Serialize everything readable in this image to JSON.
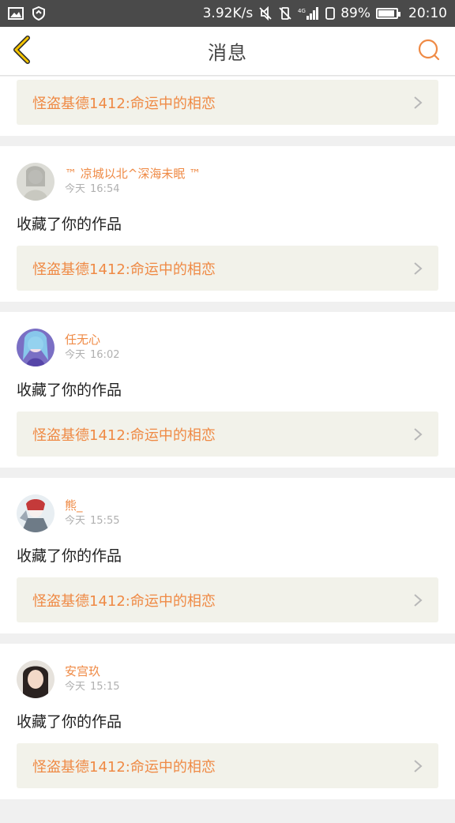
{
  "status_bar": {
    "speed": "3.92K/s",
    "network": "4G",
    "battery_percent": "89%",
    "battery_level": 0.89,
    "time": "20:10",
    "icons": [
      "gallery-icon",
      "shield-icon",
      "mute-icon",
      "vibrate-off-icon",
      "signal-icon",
      "sim-icon",
      "battery-icon"
    ]
  },
  "header": {
    "title": "消息",
    "back_icon": "chevron-left-icon",
    "search_icon": "search-icon",
    "accent": "#ef8a45"
  },
  "work_title": "怪盗基德1412:命运中的相恋",
  "notifications": [
    {
      "username": "™ 凉城以北^深海未眠 ™",
      "day": "今天",
      "time": "16:54",
      "action": "收藏了你的作品",
      "work": "怪盗基德1412:命运中的相恋"
    },
    {
      "username": "任无心",
      "day": "今天",
      "time": "16:02",
      "action": "收藏了你的作品",
      "work": "怪盗基德1412:命运中的相恋"
    },
    {
      "username": "熊_",
      "day": "今天",
      "time": "15:55",
      "action": "收藏了你的作品",
      "work": "怪盗基德1412:命运中的相恋"
    },
    {
      "username": "安宫玖",
      "day": "今天",
      "time": "15:15",
      "action": "收藏了你的作品",
      "work": "怪盗基德1412:命运中的相恋"
    }
  ]
}
